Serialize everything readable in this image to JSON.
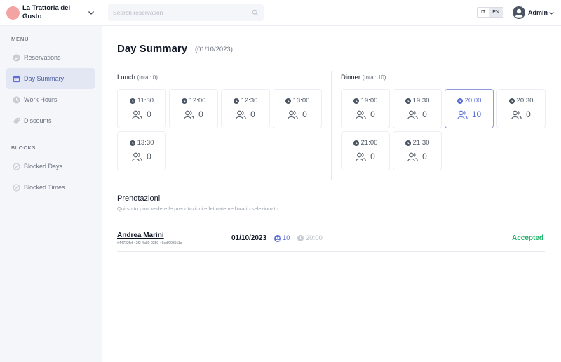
{
  "header": {
    "restaurant_name": "La Trattoria del Gusto",
    "search_placeholder": "Search reservation",
    "languages": [
      {
        "code": "IT",
        "active": false
      },
      {
        "code": "EN",
        "active": true
      }
    ],
    "user_name": "Admin"
  },
  "sidebar": {
    "menu_title": "MENU",
    "menu_items": [
      {
        "label": "Reservations",
        "icon": "check-circle-icon",
        "active": false
      },
      {
        "label": "Day Summary",
        "icon": "calendar-icon",
        "active": true
      },
      {
        "label": "Work Hours",
        "icon": "clock-icon",
        "active": false
      },
      {
        "label": "Discounts",
        "icon": "tag-icon",
        "active": false
      }
    ],
    "blocks_title": "BLOCKS",
    "block_items": [
      {
        "label": "Blocked Days",
        "icon": "ban-icon"
      },
      {
        "label": "Blocked Times",
        "icon": "ban-icon"
      }
    ]
  },
  "page": {
    "title": "Day Summary",
    "date": "(01/10/2023)"
  },
  "lunch": {
    "label": "Lunch",
    "total": "(total: 0)",
    "slots": [
      {
        "time": "11:30",
        "count": "0"
      },
      {
        "time": "12:00",
        "count": "0"
      },
      {
        "time": "12:30",
        "count": "0"
      },
      {
        "time": "13:00",
        "count": "0"
      },
      {
        "time": "13:30",
        "count": "0"
      }
    ]
  },
  "dinner": {
    "label": "Dinner",
    "total": "(total: 10)",
    "selected_time": "20:00",
    "slots": [
      {
        "time": "19:00",
        "count": "0"
      },
      {
        "time": "19:30",
        "count": "0"
      },
      {
        "time": "20:00",
        "count": "10"
      },
      {
        "time": "20:30",
        "count": "0"
      },
      {
        "time": "21:00",
        "count": "0"
      },
      {
        "time": "21:30",
        "count": "0"
      }
    ]
  },
  "bookings": {
    "title": "Prenotazioni",
    "subtitle": "Qui sotto puoi vedere le prenotazioni effettuate nell'orario selezionato.",
    "rows": [
      {
        "name": "Andrea Marini",
        "id": "#44732fef-42f2-4a80-9259-49ddf903911c",
        "date": "01/10/2023",
        "guests": "10",
        "time": "20:00",
        "status": "Accepted"
      }
    ]
  },
  "colors": {
    "accent": "#5b6fd6",
    "status_accepted": "#1fb36b",
    "brand_logo": "#f4a3a3",
    "sidebar_bg": "#f5f6f9"
  }
}
